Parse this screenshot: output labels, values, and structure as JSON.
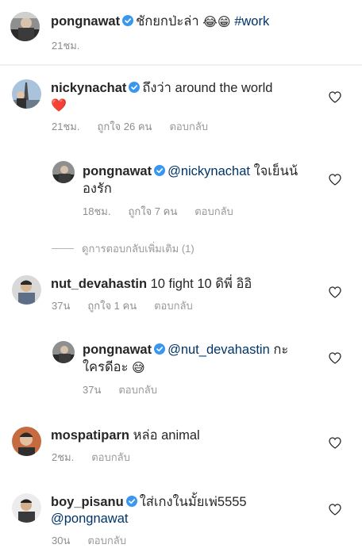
{
  "caption": {
    "username": "pongnawat",
    "text": "ชักยกป่ะล่า",
    "emojis": "😂😁",
    "hashtag": "#work",
    "time": "21ชม."
  },
  "comments": [
    {
      "username": "nickynachat",
      "text": "ถึงว่า around the world",
      "emoji": "❤️",
      "time": "21ชม.",
      "likes": "ถูกใจ 26 คน",
      "reply": "ตอบกลับ"
    },
    {
      "username": "pongnawat",
      "mention": "@nickynachat",
      "text_line1": "ใจเย็นน้",
      "text_line2": "องรัก",
      "time": "18ชม.",
      "likes": "ถูกใจ 7 คน",
      "reply": "ตอบกลับ"
    },
    {
      "username": "nut_devahastin",
      "text": "10 fight 10 ดิพี่ อิอิ",
      "time": "37น",
      "likes": "ถูกใจ 1 คน",
      "reply": "ตอบกลับ"
    },
    {
      "username": "pongnawat",
      "mention": "@nut_devahastin",
      "text_line1": "กะ",
      "text_line2": "ใครดีอะ",
      "emoji": "😅",
      "time": "37น",
      "reply": "ตอบกลับ"
    },
    {
      "username": "mospatiparn",
      "text": "หล่อ animal",
      "time": "2ชม.",
      "reply": "ตอบกลับ"
    },
    {
      "username": "boy_pisanu",
      "text": "ใส่เกงในมั้ยเพ่5555",
      "mention": "@pongnawat",
      "time": "30น",
      "reply": "ตอบกลับ"
    }
  ],
  "more_replies": "ดูการตอบกลับเพิ่มเติม (1)",
  "colors": {
    "text": "#262626",
    "meta": "#8e8e8e",
    "link": "#003569",
    "verified": "#3897f0"
  }
}
